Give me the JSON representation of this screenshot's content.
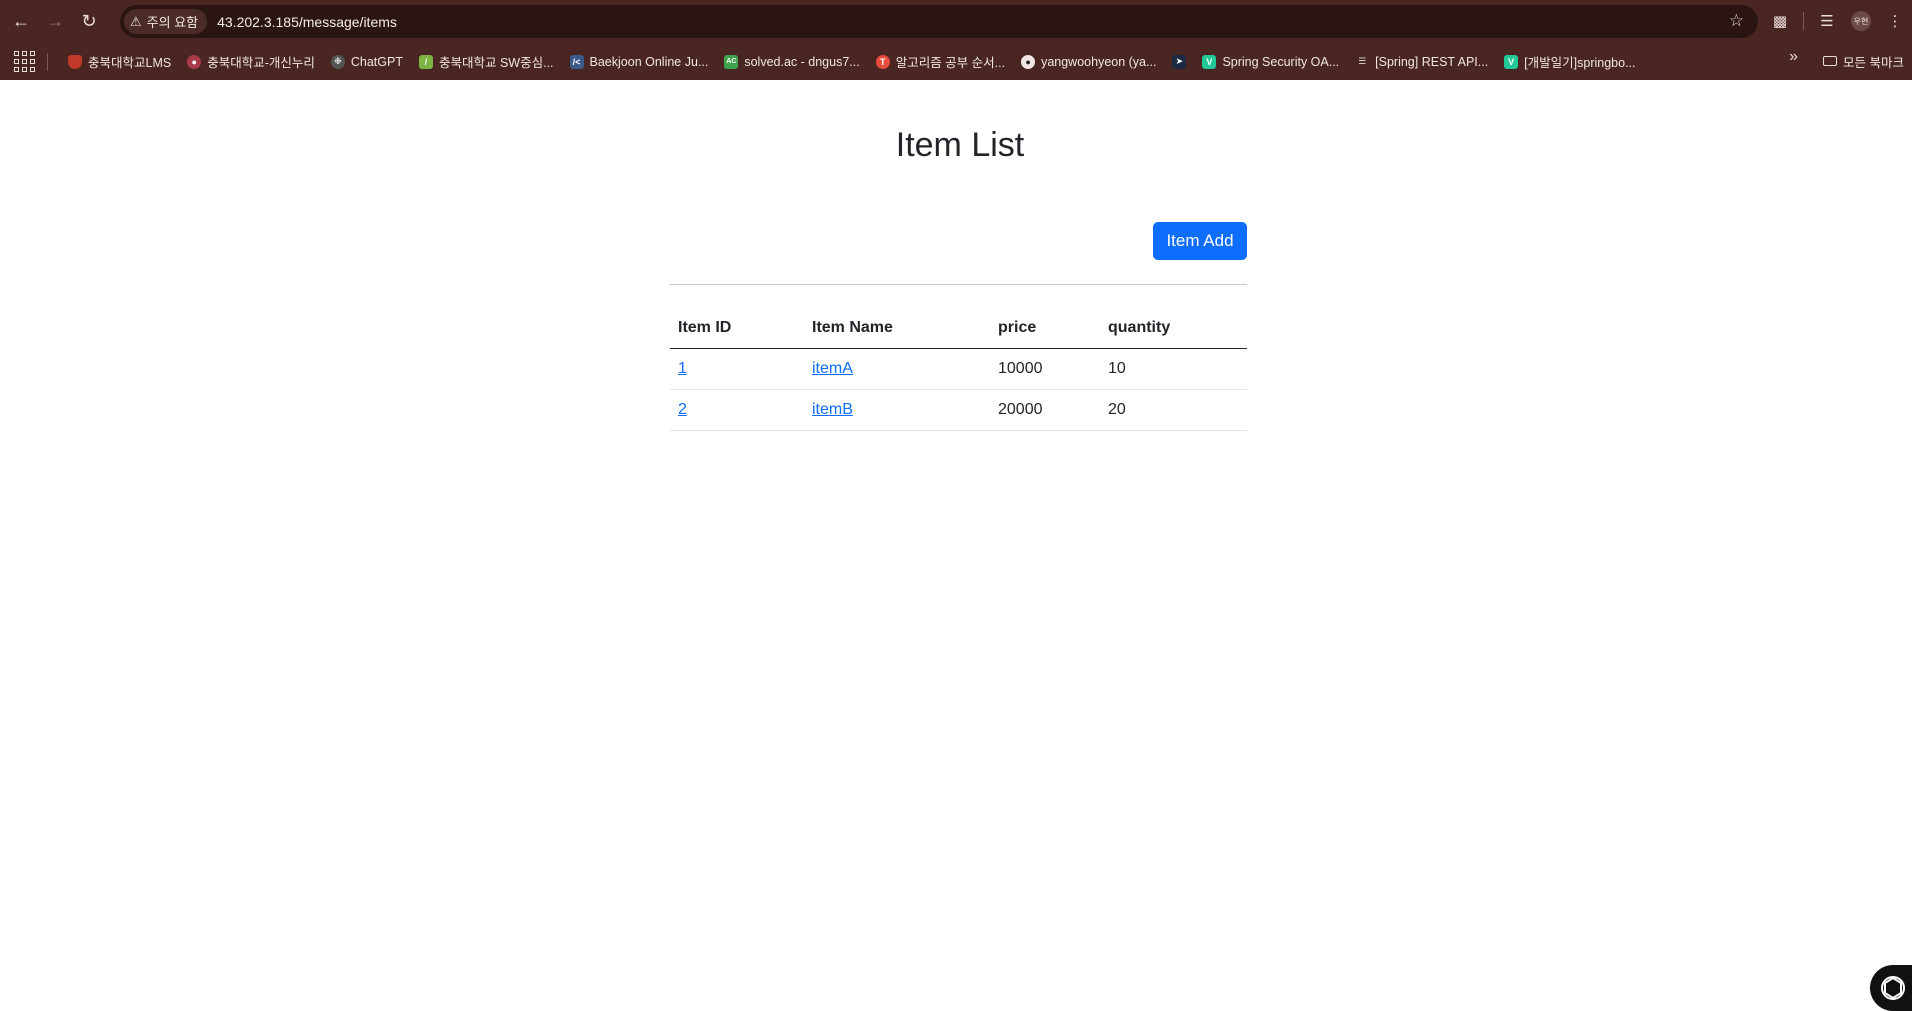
{
  "browser": {
    "security_label": "주의 요함",
    "url": "43.202.3.185/message/items",
    "profile_initials": "우현",
    "bookmarks": [
      {
        "label": "충북대학교LMS",
        "color": "#c0392b"
      },
      {
        "label": "충북대학교-개신누리",
        "color": "#a93a4a"
      },
      {
        "label": "ChatGPT",
        "color": "#555555"
      },
      {
        "label": "충북대학교 SW중심...",
        "color": "#7cb342"
      },
      {
        "label": "Baekjoon Online Ju...",
        "color": "#3a5a8c"
      },
      {
        "label": "solved.ac - dngus7...",
        "color": "#3fa34d"
      },
      {
        "label": "알고리즘 공부 순서...",
        "color": "#e74c3c"
      },
      {
        "label": "yangwoohyeon (ya...",
        "color": "#222222"
      },
      {
        "label": "",
        "color": "#1e2a44"
      },
      {
        "label": "Spring Security OA...",
        "color": "#20c997"
      },
      {
        "label": "[Spring] REST API...",
        "color": "#888888"
      },
      {
        "label": "[개발일기]springbo...",
        "color": "#20c997"
      }
    ],
    "all_bookmarks_label": "모든 북마크"
  },
  "page": {
    "title": "Item List",
    "add_button_label": "Item Add",
    "table": {
      "headers": [
        "Item ID",
        "Item Name",
        "price",
        "quantity"
      ],
      "rows": [
        {
          "id": "1",
          "name": "itemA",
          "price": "10000",
          "quantity": "10"
        },
        {
          "id": "2",
          "name": "itemB",
          "price": "20000",
          "quantity": "20"
        }
      ]
    }
  },
  "colors": {
    "accent": "#0d6efd",
    "browser_frame": "#4a2622",
    "text": "#212529"
  }
}
